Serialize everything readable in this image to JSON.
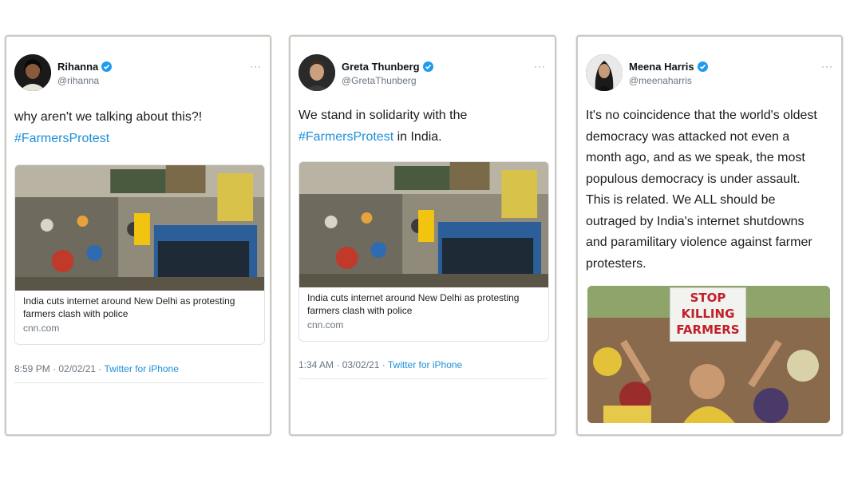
{
  "tweets": [
    {
      "name": "Rihanna",
      "handle": "@rihanna",
      "more": "···",
      "text_plain": "why aren't we talking about this?!",
      "hashtag": "#FarmersProtest",
      "link_title": "India cuts internet around New Delhi as protesting farmers clash with police",
      "link_domain": "cnn.com",
      "time": "8:59 PM · 02/02/21 · ",
      "app": "Twitter for iPhone"
    },
    {
      "name": "Greta Thunberg",
      "handle": "@GretaThunberg",
      "more": "···",
      "text_plain": "We stand in solidarity with the",
      "hashtag": "#FarmersProtest",
      "text_after": " in India.",
      "link_title": "India cuts internet around New Delhi as protesting farmers clash with police",
      "link_domain": "cnn.com",
      "time": "1:34 AM · 03/02/21 · ",
      "app": "Twitter for iPhone"
    },
    {
      "name": "Meena Harris",
      "handle": "@meenaharris",
      "more": "···",
      "text_plain": "It's no coincidence that the world's oldest democracy was attacked not even a month ago, and as we speak, the most populous democracy is under assault. This is related. We ALL should be outraged by India's internet shutdowns and paramilitary violence against farmer protesters.",
      "sign": [
        "STOP",
        "KILLING",
        "FARMERS"
      ]
    }
  ],
  "colors": {
    "link": "#1d8fd8",
    "verified": "#1d9bf0",
    "muted": "#6b7580"
  },
  "icons": [
    "verified-badge-icon",
    "more-options-icon"
  ]
}
